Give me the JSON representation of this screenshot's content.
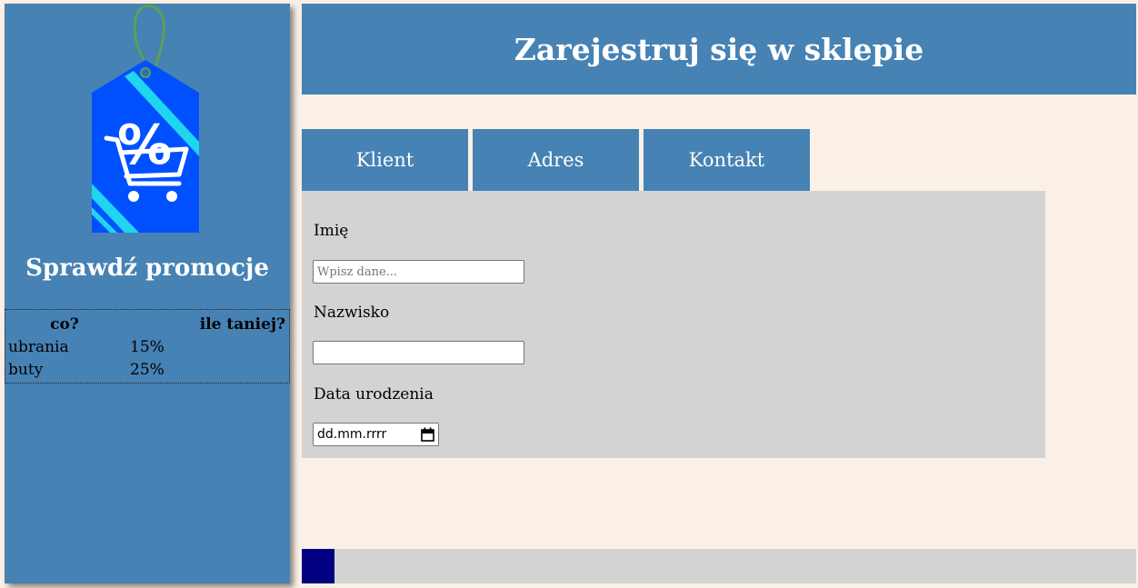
{
  "sidebar": {
    "promo_title": "Sprawdź promocje",
    "tag_icon": "percent-cart-tag",
    "table": {
      "headers": [
        "co?",
        "ile taniej?"
      ],
      "rows": [
        [
          "ubrania",
          "15%"
        ],
        [
          "buty",
          "25%"
        ]
      ]
    }
  },
  "header": {
    "title": "Zarejestruj się w sklepie"
  },
  "tabs": [
    {
      "label": "Klient"
    },
    {
      "label": "Adres"
    },
    {
      "label": "Kontakt"
    }
  ],
  "form": {
    "first_name_label": "Imię",
    "first_name_placeholder": "Wpisz dane...",
    "first_name_value": "",
    "last_name_label": "Nazwisko",
    "last_name_value": "",
    "birthdate_label": "Data urodzenia",
    "birthdate_placeholder": "dd.mm.rrrr"
  },
  "colors": {
    "page_bg": "#FAF0E6",
    "panel_blue": "#4682B4",
    "form_bg": "#D3D3D3",
    "footer_accent": "#000080",
    "tag_blue": "#0050FF",
    "tag_stripe": "#1FD5F0"
  }
}
